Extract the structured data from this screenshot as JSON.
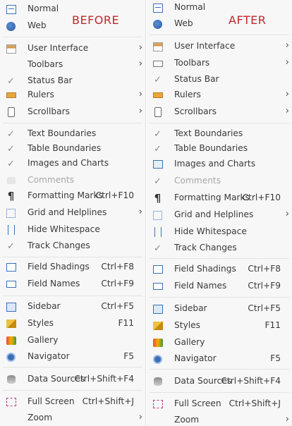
{
  "before": {
    "tag": "BEFORE",
    "items": [
      {
        "label": "Normal",
        "icon": "normal-view-icon"
      },
      {
        "label": "Web",
        "icon": "web-view-icon"
      },
      {
        "label": "User Interface",
        "icon": "user-interface-icon",
        "submenu": true
      },
      {
        "label": "Toolbars",
        "icon": "",
        "submenu": true
      },
      {
        "label": "Status Bar",
        "icon": "check-icon"
      },
      {
        "label": "Rulers",
        "icon": "ruler-icon",
        "submenu": true
      },
      {
        "label": "Scrollbars",
        "icon": "scrollbar-icon",
        "submenu": true
      },
      {
        "label": "Text Boundaries",
        "icon": "check-icon"
      },
      {
        "label": "Table Boundaries",
        "icon": "check-icon"
      },
      {
        "label": "Images and Charts",
        "icon": "check-icon"
      },
      {
        "label": "Comments",
        "icon": "comment-icon",
        "disabled": true
      },
      {
        "label": "Formatting Marks",
        "icon": "pilcrow-icon",
        "shortcut": "Ctrl+F10"
      },
      {
        "label": "Grid and Helplines",
        "icon": "grid-icon",
        "submenu": true
      },
      {
        "label": "Hide Whitespace",
        "icon": "whitespace-icon"
      },
      {
        "label": "Track Changes",
        "icon": "check-icon"
      },
      {
        "label": "Field Shadings",
        "icon": "field-shadings-icon",
        "shortcut": "Ctrl+F8"
      },
      {
        "label": "Field Names",
        "icon": "field-names-icon",
        "shortcut": "Ctrl+F9"
      },
      {
        "label": "Sidebar",
        "icon": "sidebar-icon",
        "shortcut": "Ctrl+F5"
      },
      {
        "label": "Styles",
        "icon": "styles-icon",
        "shortcut": "F11"
      },
      {
        "label": "Gallery",
        "icon": "gallery-icon"
      },
      {
        "label": "Navigator",
        "icon": "navigator-icon",
        "shortcut": "F5"
      },
      {
        "label": "Data Sources",
        "icon": "data-sources-icon",
        "shortcut": "Ctrl+Shift+F4"
      },
      {
        "label": "Full Screen",
        "icon": "full-screen-icon",
        "shortcut": "Ctrl+Shift+J"
      },
      {
        "label": "Zoom",
        "icon": "",
        "submenu": true
      }
    ]
  },
  "after": {
    "tag": "AFTER",
    "items": [
      {
        "label": "Normal",
        "icon": "normal-view-icon"
      },
      {
        "label": "Web",
        "icon": "web-view-icon"
      },
      {
        "label": "User Interface",
        "icon": "user-interface-icon",
        "submenu": true
      },
      {
        "label": "Toolbars",
        "icon": "toolbars-icon",
        "submenu": true
      },
      {
        "label": "Status Bar",
        "icon": "check-icon"
      },
      {
        "label": "Rulers",
        "icon": "ruler-icon",
        "submenu": true
      },
      {
        "label": "Scrollbars",
        "icon": "scrollbar-icon",
        "submenu": true
      },
      {
        "label": "Text Boundaries",
        "icon": "check-icon"
      },
      {
        "label": "Table Boundaries",
        "icon": "check-icon"
      },
      {
        "label": "Images and Charts",
        "icon": "images-charts-icon"
      },
      {
        "label": "Comments",
        "icon": "check-icon",
        "disabled": true
      },
      {
        "label": "Formatting Marks",
        "icon": "pilcrow-icon",
        "shortcut": "Ctrl+F10"
      },
      {
        "label": "Grid and Helplines",
        "icon": "grid-icon",
        "submenu": true
      },
      {
        "label": "Hide Whitespace",
        "icon": "whitespace-icon"
      },
      {
        "label": "Track Changes",
        "icon": "check-icon"
      },
      {
        "label": "Field Shadings",
        "icon": "field-shadings-icon",
        "shortcut": "Ctrl+F8"
      },
      {
        "label": "Field Names",
        "icon": "field-names-icon",
        "shortcut": "Ctrl+F9"
      },
      {
        "label": "Sidebar",
        "icon": "sidebar-icon",
        "shortcut": "Ctrl+F5"
      },
      {
        "label": "Styles",
        "icon": "styles-icon",
        "shortcut": "F11"
      },
      {
        "label": "Gallery",
        "icon": "gallery-icon"
      },
      {
        "label": "Navigator",
        "icon": "navigator-icon",
        "shortcut": "F5"
      },
      {
        "label": "Data Sources",
        "icon": "data-sources-icon",
        "shortcut": "Ctrl+Shift+F4"
      },
      {
        "label": "Full Screen",
        "icon": "full-screen-icon",
        "shortcut": "Ctrl+Shift+J"
      },
      {
        "label": "Zoom",
        "icon": "",
        "submenu": true
      }
    ]
  }
}
